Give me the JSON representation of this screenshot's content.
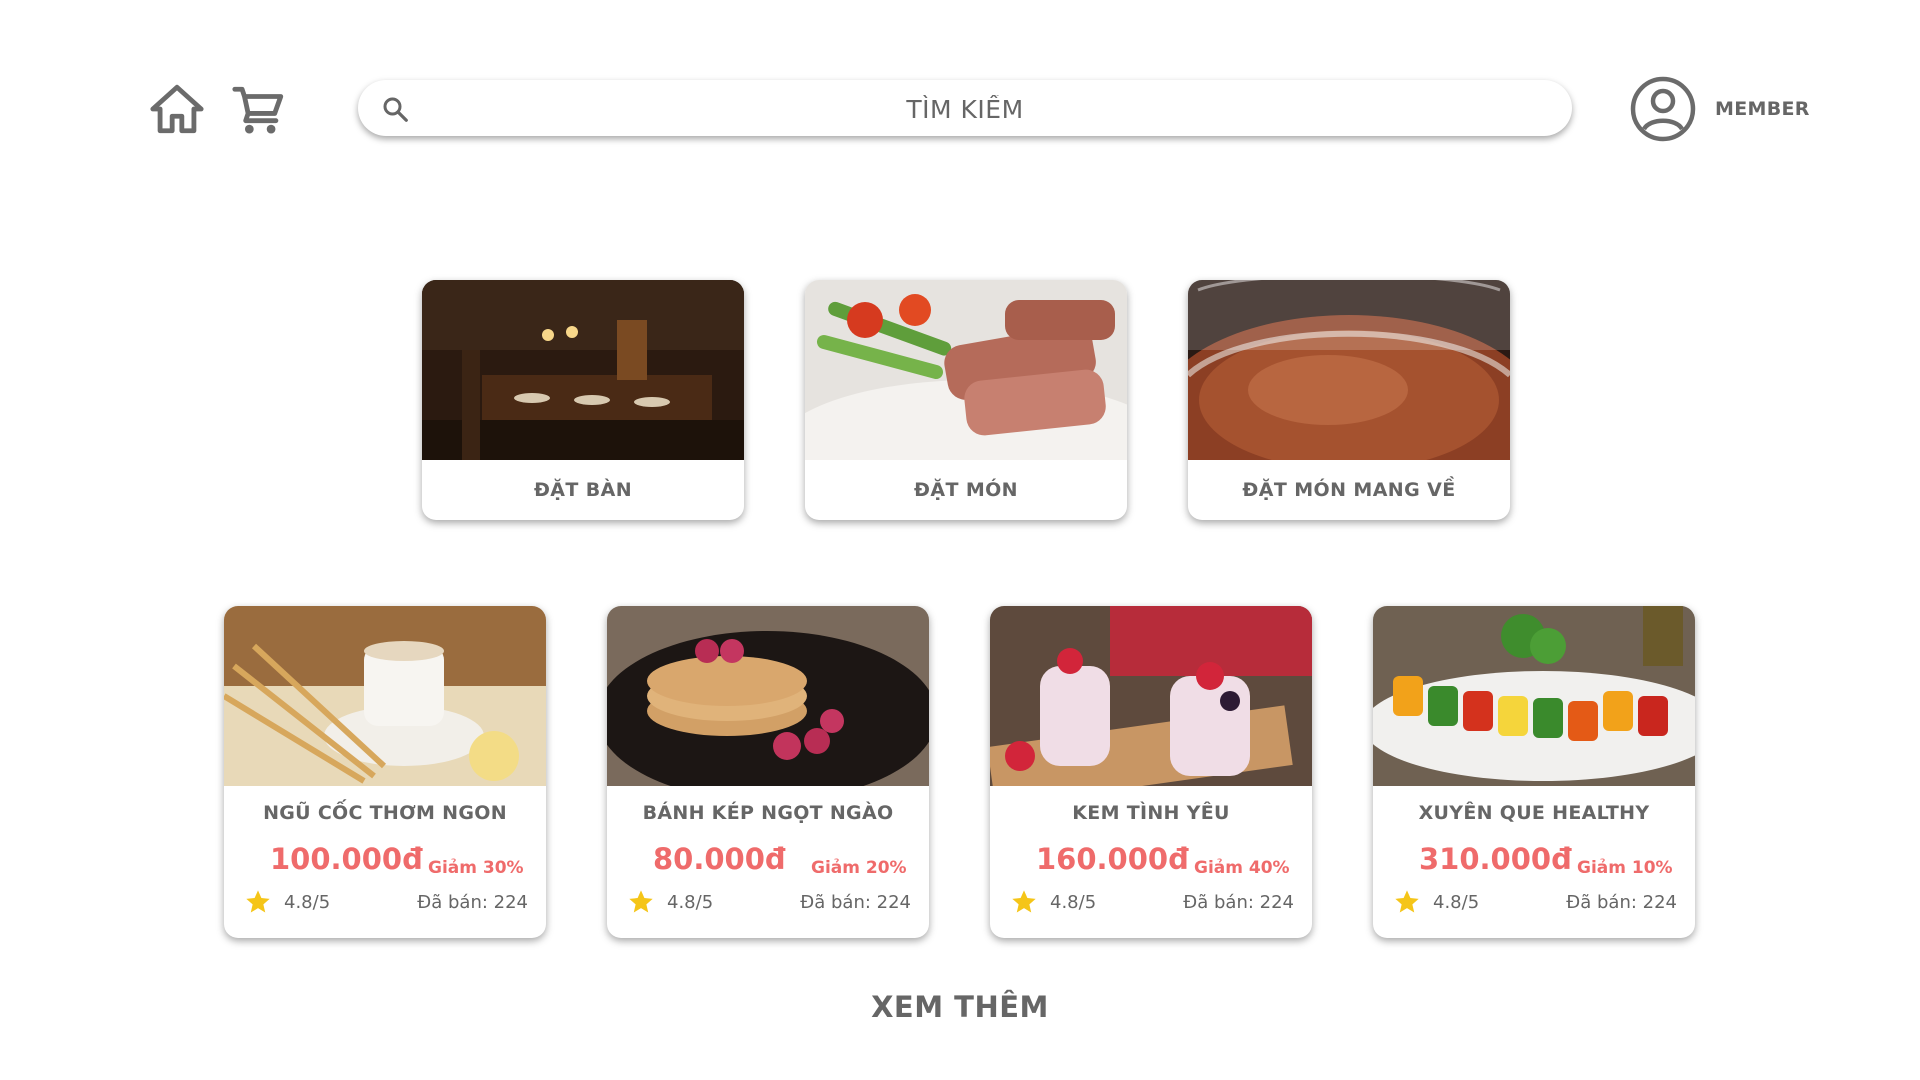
{
  "header": {
    "search_placeholder": "TÌM KIẾM",
    "member_label": "MEMBER",
    "icons": [
      "home-icon",
      "cart-icon",
      "search-icon",
      "user-avatar-icon"
    ]
  },
  "services": [
    {
      "label": "ĐẶT BÀN"
    },
    {
      "label": "ĐẶT MÓN"
    },
    {
      "label": "ĐẶT MÓN MANG VỀ"
    }
  ],
  "products": [
    {
      "name": "NGŨ CỐC THƠM NGON",
      "price": "100.000đ",
      "discount": "Giảm 30%",
      "rating": "4.8/5",
      "sold": "Đã bán: 224"
    },
    {
      "name": "BÁNH KÉP NGỌT NGÀO",
      "price": "80.000đ",
      "discount": "Giảm 20%",
      "rating": "4.8/5",
      "sold": "Đã bán: 224"
    },
    {
      "name": "KEM TÌNH YÊU",
      "price": "160.000đ",
      "discount": "Giảm 40%",
      "rating": "4.8/5",
      "sold": "Đã bán: 224"
    },
    {
      "name": "XUYÊN QUE HEALTHY",
      "price": "310.000đ",
      "discount": "Giảm 10%",
      "rating": "4.8/5",
      "sold": "Đã bán: 224"
    }
  ],
  "see_more_label": "XEM THÊM",
  "colors": {
    "price": "#ef6b6b",
    "text": "#666666",
    "star": "#f5c518"
  }
}
